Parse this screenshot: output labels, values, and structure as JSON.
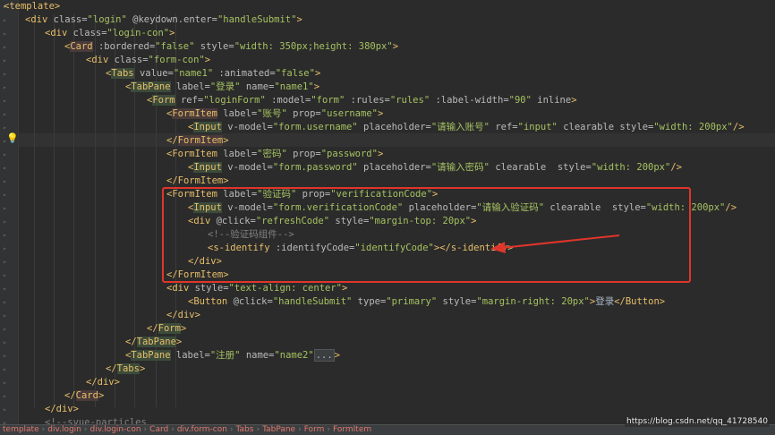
{
  "editor": {
    "lines": [
      [
        [
          "tag",
          "<template>"
        ]
      ],
      [
        [
          "tag",
          "<div "
        ],
        [
          "attr",
          "class="
        ],
        [
          "val",
          "\"login\" "
        ],
        [
          "attr",
          "@keydown.enter="
        ],
        [
          "val",
          "\"handleSubmit\""
        ],
        [
          "tag",
          ">"
        ]
      ],
      [
        [
          "tag",
          "<div "
        ],
        [
          "attr",
          "class="
        ],
        [
          "val",
          "\"login-con\""
        ],
        [
          "tag",
          ">"
        ]
      ],
      [
        [
          "tag",
          "<"
        ],
        [
          "tagbg3",
          "Card"
        ],
        [
          "attr",
          " :bordered="
        ],
        [
          "val",
          "\"false\" "
        ],
        [
          "attr",
          "style="
        ],
        [
          "val",
          "\"width: 350px;height: 380px\""
        ],
        [
          "tag",
          ">"
        ]
      ],
      [
        [
          "tag",
          "<div "
        ],
        [
          "attr",
          "class="
        ],
        [
          "val",
          "\"form-con\""
        ],
        [
          "tag",
          ">"
        ]
      ],
      [
        [
          "tag",
          "<"
        ],
        [
          "tagbg",
          "Tabs"
        ],
        [
          "attr",
          " value="
        ],
        [
          "val",
          "\"name1\" "
        ],
        [
          "attr",
          ":animated="
        ],
        [
          "val",
          "\"false\""
        ],
        [
          "tag",
          ">"
        ]
      ],
      [
        [
          "tag",
          "<"
        ],
        [
          "tagbg",
          "TabPane"
        ],
        [
          "attr",
          " label="
        ],
        [
          "val",
          "\"登录\" "
        ],
        [
          "attr",
          "name="
        ],
        [
          "val",
          "\"name1\""
        ],
        [
          "tag",
          ">"
        ]
      ],
      [
        [
          "tag",
          "<"
        ],
        [
          "tagbg",
          "Form"
        ],
        [
          "attr",
          " ref="
        ],
        [
          "val",
          "\"loginForm\" "
        ],
        [
          "attr",
          ":model="
        ],
        [
          "val",
          "\"form\" "
        ],
        [
          "attr",
          ":rules="
        ],
        [
          "val",
          "\"rules\" "
        ],
        [
          "attr",
          ":label-width="
        ],
        [
          "val",
          "\"90\" "
        ],
        [
          "attr",
          "inline"
        ],
        [
          "tag",
          ">"
        ]
      ],
      [
        [
          "tag",
          "<"
        ],
        [
          "tagbg3",
          "FormItem"
        ],
        [
          "attr",
          " label="
        ],
        [
          "val",
          "\"账号\" "
        ],
        [
          "attr",
          "prop="
        ],
        [
          "val",
          "\"username\""
        ],
        [
          "tag",
          ">"
        ]
      ],
      [
        [
          "tag",
          "<"
        ],
        [
          "tagbg",
          "Input"
        ],
        [
          "attr",
          " v-model="
        ],
        [
          "val",
          "\"form.username\" "
        ],
        [
          "attr",
          "placeholder="
        ],
        [
          "val",
          "\"请输入账号\" "
        ],
        [
          "attr",
          "ref="
        ],
        [
          "val",
          "\"input\" "
        ],
        [
          "attr",
          "clearable style="
        ],
        [
          "val",
          "\"width: 200px\""
        ],
        [
          "tag",
          "/>"
        ]
      ],
      [
        [
          "tag",
          "</"
        ],
        [
          "tagbg3",
          "FormItem"
        ],
        [
          "tag",
          ">"
        ]
      ],
      [
        [
          "tag",
          "<FormItem "
        ],
        [
          "attr",
          "label="
        ],
        [
          "val",
          "\"密码\" "
        ],
        [
          "attr",
          "prop="
        ],
        [
          "val",
          "\"password\""
        ],
        [
          "tag",
          ">"
        ]
      ],
      [
        [
          "tag",
          "<"
        ],
        [
          "tagbg",
          "Input"
        ],
        [
          "attr",
          " v-model="
        ],
        [
          "val",
          "\"form.password\" "
        ],
        [
          "attr",
          "placeholder="
        ],
        [
          "val",
          "\"请输入密码\" "
        ],
        [
          "attr",
          "clearable  style="
        ],
        [
          "val",
          "\"width: 200px\""
        ],
        [
          "tag",
          "/>"
        ]
      ],
      [
        [
          "tag",
          "</FormItem>"
        ]
      ],
      [
        [
          "tag",
          "<FormItem "
        ],
        [
          "attr",
          "label="
        ],
        [
          "val",
          "\"验证码\" "
        ],
        [
          "attr",
          "prop="
        ],
        [
          "val",
          "\"verificationCode\""
        ],
        [
          "tag",
          ">"
        ]
      ],
      [
        [
          "tag",
          "<"
        ],
        [
          "tagbg",
          "Input"
        ],
        [
          "attr",
          " v-model="
        ],
        [
          "val",
          "\"form.verificationCode\" "
        ],
        [
          "attr",
          "placeholder="
        ],
        [
          "val",
          "\"请输入验证码\" "
        ],
        [
          "attr",
          "clearable  style="
        ],
        [
          "val",
          "\"width: 200px\""
        ],
        [
          "tag",
          "/>"
        ]
      ],
      [
        [
          "tag",
          "<div "
        ],
        [
          "attr",
          "@click="
        ],
        [
          "val",
          "\"refreshCode\" "
        ],
        [
          "attr",
          "style="
        ],
        [
          "val",
          "\"margin-top: 20px\""
        ],
        [
          "tag",
          ">"
        ]
      ],
      [
        [
          "cm",
          "<!--验证码组件-->"
        ]
      ],
      [
        [
          "tag",
          "<s-identify "
        ],
        [
          "attr",
          ":identifyCode="
        ],
        [
          "val",
          "\"identifyCode\""
        ],
        [
          "tag",
          "></s-identify>"
        ]
      ],
      [
        [
          "tag",
          "</div>"
        ]
      ],
      [
        [
          "tag",
          "</FormItem>"
        ]
      ],
      [
        [
          "tag",
          "<div "
        ],
        [
          "attr",
          "style="
        ],
        [
          "val",
          "\"text-align: center\""
        ],
        [
          "tag",
          ">"
        ]
      ],
      [
        [
          "tag",
          "<Button "
        ],
        [
          "attr",
          "@click="
        ],
        [
          "val",
          "\"handleSubmit\" "
        ],
        [
          "attr",
          "type="
        ],
        [
          "val",
          "\"primary\" "
        ],
        [
          "attr",
          "style="
        ],
        [
          "val",
          "\"margin-right: 20px\""
        ],
        [
          "tag",
          ">"
        ],
        [
          "txt",
          "登录"
        ],
        [
          "tag",
          "</Button>"
        ]
      ],
      [
        [
          "tag",
          "</div>"
        ]
      ],
      [
        [
          "tag",
          "</"
        ],
        [
          "tagbg",
          "Form"
        ],
        [
          "tag",
          ">"
        ]
      ],
      [
        [
          "tag",
          "</"
        ],
        [
          "tagbg",
          "TabPane"
        ],
        [
          "tag",
          ">"
        ]
      ],
      [
        [
          "tag",
          "<"
        ],
        [
          "tagbg",
          "TabPane"
        ],
        [
          "attr",
          " label="
        ],
        [
          "val",
          "\"注册\" "
        ],
        [
          "attr",
          "name="
        ],
        [
          "val",
          "\"name2\""
        ],
        [
          "fold",
          "..."
        ],
        [
          "tag",
          ">"
        ]
      ],
      [
        [
          "tag",
          "</"
        ],
        [
          "tagbg",
          "Tabs"
        ],
        [
          "tag",
          ">"
        ]
      ],
      [
        [
          "tag",
          "</div>"
        ]
      ],
      [
        [
          "tag",
          "</"
        ],
        [
          "tagbg3",
          "Card"
        ],
        [
          "tag",
          ">"
        ]
      ],
      [
        [
          "tag",
          "</div>"
        ]
      ],
      [
        [
          "cm",
          "<!--svue-particles"
        ]
      ]
    ]
  },
  "breadcrumb": [
    "template",
    "div.login",
    "div.login-con",
    "Card",
    "div.form-con",
    "Tabs",
    "TabPane",
    "Form",
    "FormItem"
  ],
  "watermark": "https://blog.csdn.net/qq_41728540",
  "colors": {
    "background": "#2b2b2b",
    "tag": "#e8bf6a",
    "attribute": "#bababa",
    "string": "#a5c261",
    "comment": "#808080",
    "highlight_box": "#e0352b"
  }
}
